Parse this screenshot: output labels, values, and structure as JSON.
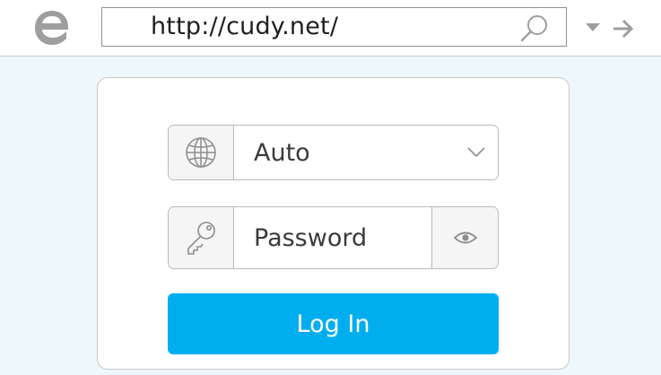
{
  "browser": {
    "logo_icon": "edge-logo-icon",
    "address_url": "http://cudy.net/",
    "search_icon": "search-icon",
    "dropdown_icon": "dropdown-arrow-icon",
    "go_icon": "go-arrow-icon"
  },
  "login": {
    "language": {
      "icon": "globe-icon",
      "selected": "Auto",
      "dropdown_icon": "chevron-down-icon"
    },
    "password": {
      "icon": "key-icon",
      "placeholder": "Password",
      "value": "",
      "reveal_icon": "eye-icon"
    },
    "login_button_label": "Log In"
  },
  "colors": {
    "page_background": "#eef8fc",
    "accent": "#00aeef",
    "icon_gray": "#9e9e9e",
    "field_border": "#b9b9b9"
  }
}
